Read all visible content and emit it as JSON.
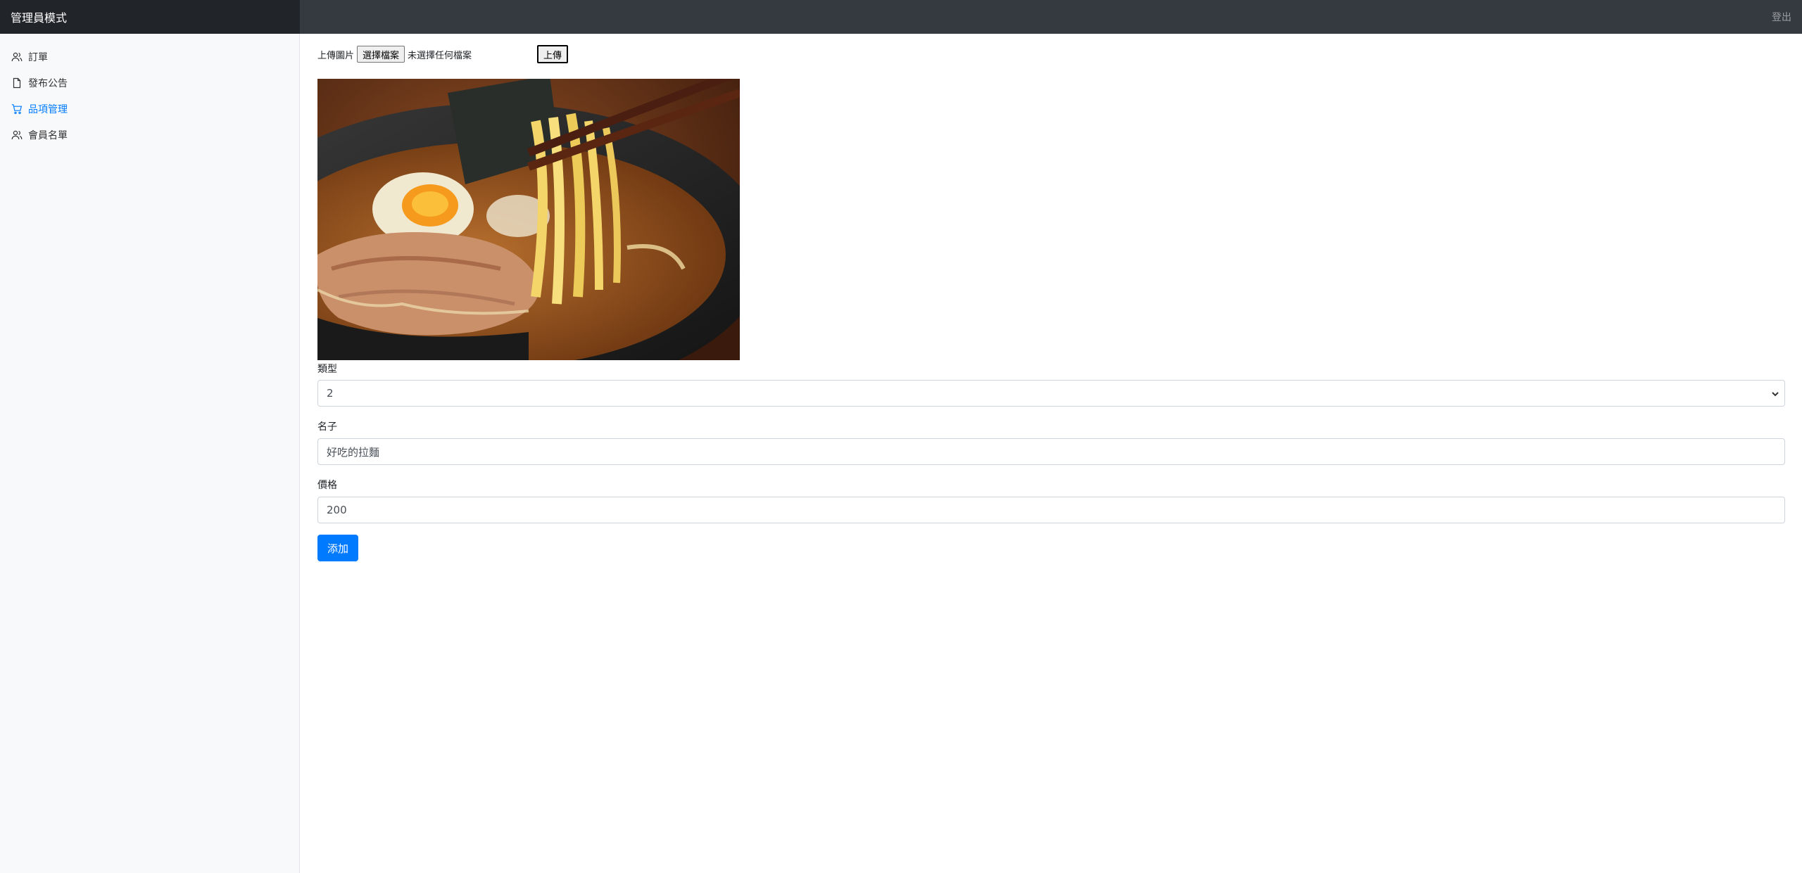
{
  "header": {
    "brand": "管理員模式",
    "signout": "登出"
  },
  "sidebar": {
    "items": [
      {
        "label": "訂單",
        "icon": "users-icon",
        "active": false
      },
      {
        "label": "發布公告",
        "icon": "file-icon",
        "active": false
      },
      {
        "label": "品項管理",
        "icon": "shopping-cart-icon",
        "active": true
      },
      {
        "label": "會員名單",
        "icon": "users-icon",
        "active": false
      }
    ]
  },
  "upload": {
    "label": "上傳圖片",
    "choose_button": "選擇檔案",
    "file_status": "未選擇任何檔案",
    "upload_button": "上傳"
  },
  "form": {
    "type_label": "類型",
    "type_value": "2",
    "name_label": "名子",
    "name_value": "好吃的拉麵",
    "price_label": "價格",
    "price_value": "200",
    "submit_label": "添加"
  },
  "colors": {
    "accent": "#007bff",
    "topbar": "#343a40",
    "sidebar": "#f8f9fa"
  }
}
